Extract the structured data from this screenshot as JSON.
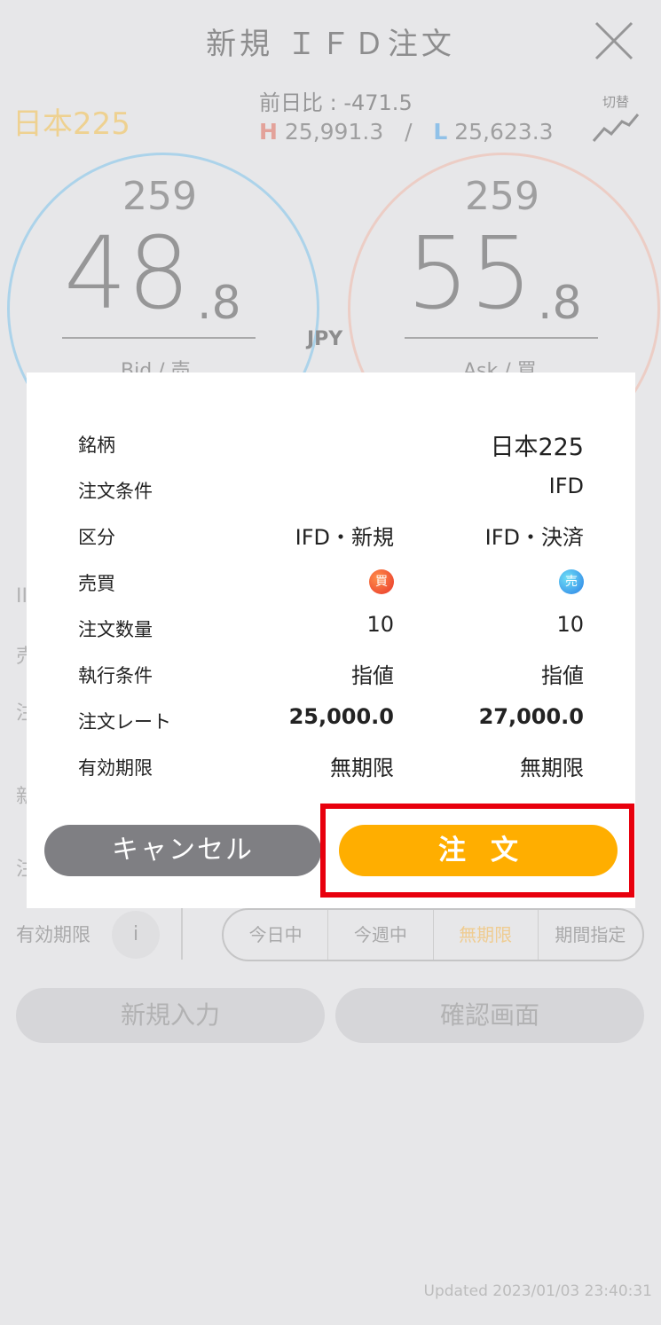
{
  "header": {
    "title": "新規 ＩＦＤ注文"
  },
  "market": {
    "symbol": "日本225",
    "prev_day_change": "前日比 : -471.5",
    "high_label": "H",
    "high": "25,991.3",
    "separator": "/",
    "low_label": "L",
    "low": "25,623.3",
    "switch_label": "切替",
    "currency": "JPY"
  },
  "bid": {
    "top": "259",
    "main": "48",
    "decimal": ".8",
    "label": "Bid / 売"
  },
  "ask": {
    "top": "259",
    "main": "55",
    "decimal": ".8",
    "label": "Ask / 買"
  },
  "form": {
    "validity_label": "有効期限",
    "info": "i",
    "validity_options": [
      "今日中",
      "今週中",
      "無期限",
      "期間指定"
    ],
    "new_input_button": "新規入力",
    "confirm_button": "確認画面",
    "fragments": [
      "II",
      "売",
      "注",
      "新",
      "注"
    ]
  },
  "updated": "Updated  2023/01/03 23:40:31",
  "dialog": {
    "rows": [
      {
        "label": "銘柄",
        "v1": "",
        "v2": "日本225"
      },
      {
        "label": "注文条件",
        "v1": "",
        "v2": "IFD"
      },
      {
        "label": "区分",
        "v1": "IFD・新規",
        "v2": "IFD・決済"
      },
      {
        "label": "売買",
        "v1": "買",
        "v2": "売"
      },
      {
        "label": "注文数量",
        "v1": "10",
        "v2": "10"
      },
      {
        "label": "執行条件",
        "v1": "指値",
        "v2": "指値"
      },
      {
        "label": "注文レート",
        "v1": "25,000.0",
        "v2": "27,000.0"
      },
      {
        "label": "有効期限",
        "v1": "無期限",
        "v2": "無期限"
      }
    ],
    "cancel_button": "キャンセル",
    "order_button": "注文"
  },
  "colors": {
    "order_button": "#ffae00",
    "cancel_button": "#7f7f83",
    "highlight_box": "#e8000d",
    "buy_badge": "#e8352a",
    "sell_badge": "#2b7fe6"
  }
}
